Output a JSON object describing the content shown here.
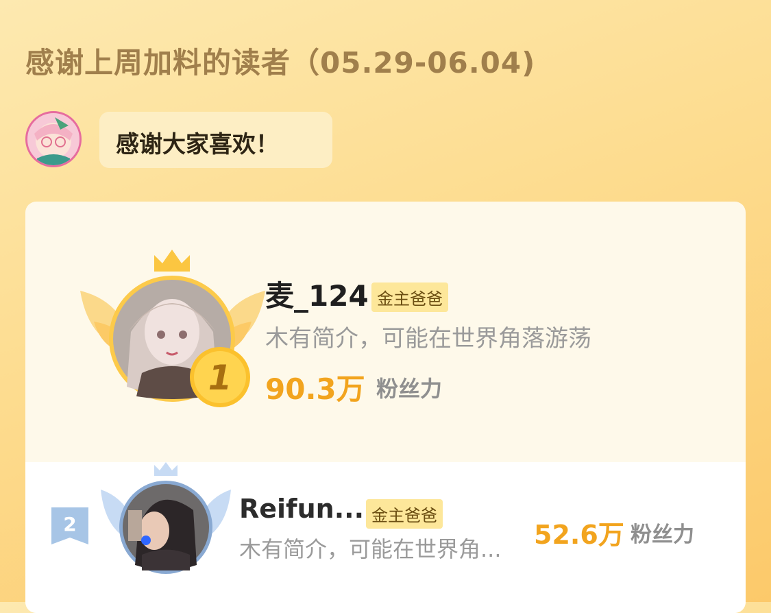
{
  "header": {
    "title": "感谢上周加料的读者（05.29-06.04)"
  },
  "greeting": {
    "text": "感谢大家喜欢！"
  },
  "ranking": [
    {
      "rank": "1",
      "name": "麦_124",
      "badge": "金主爸爸",
      "desc": "木有简介，可能在世界角落游荡",
      "fans": "90.3万",
      "fans_label": "粉丝力"
    },
    {
      "rank": "2",
      "name": "Reifun...",
      "badge": "金主爸爸",
      "desc": "木有简介，可能在世界角...",
      "fans": "52.6万",
      "fans_label": "粉丝力"
    }
  ],
  "colors": {
    "accent": "#f2a41e",
    "badge_bg": "#fde79a",
    "title": "#a07f4c"
  }
}
